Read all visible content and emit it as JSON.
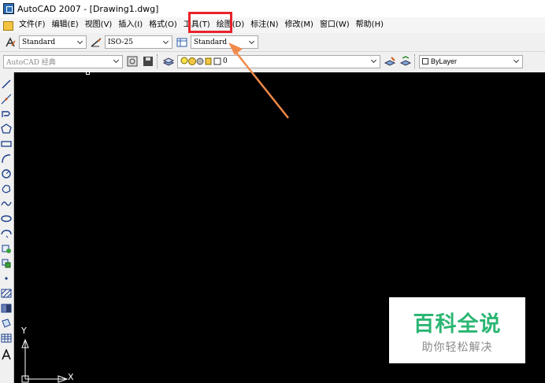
{
  "window": {
    "title": "AutoCAD 2007 - [Drawing1.dwg]"
  },
  "menu": {
    "items": [
      "文件(F)",
      "编辑(E)",
      "视图(V)",
      "插入(I)",
      "格式(O)",
      "工具(T)",
      "绘图(D)",
      "标注(N)",
      "修改(M)",
      "窗口(W)",
      "帮助(H)"
    ],
    "highlighted_index": 5
  },
  "styles_toolbar": {
    "text_style": "Standard",
    "dim_style": "ISO-25",
    "table_style": "Standard"
  },
  "layers_toolbar": {
    "workspace": "AutoCAD 经典",
    "current_layer": "0",
    "color": "ByLayer"
  },
  "ucs": {
    "x_label": "X",
    "y_label": "Y"
  },
  "watermark": {
    "title": "百科全说",
    "subtitle": "助你轻松解决"
  },
  "colors": {
    "canvas": "#000000",
    "annotation": "#e8232a",
    "arrow": "#f08a4b",
    "watermark_green": "#2bb673"
  },
  "icons": {
    "left_toolbar": [
      "line-icon",
      "construction-line-icon",
      "polyline-icon",
      "polygon-icon",
      "rectangle-icon",
      "arc-icon",
      "circle-icon",
      "revision-cloud-icon",
      "spline-icon",
      "ellipse-icon",
      "ellipse-arc-icon",
      "insert-block-icon",
      "make-block-icon",
      "point-icon",
      "hatch-icon",
      "gradient-icon",
      "region-icon",
      "table-icon",
      "multiline-text-icon"
    ]
  }
}
